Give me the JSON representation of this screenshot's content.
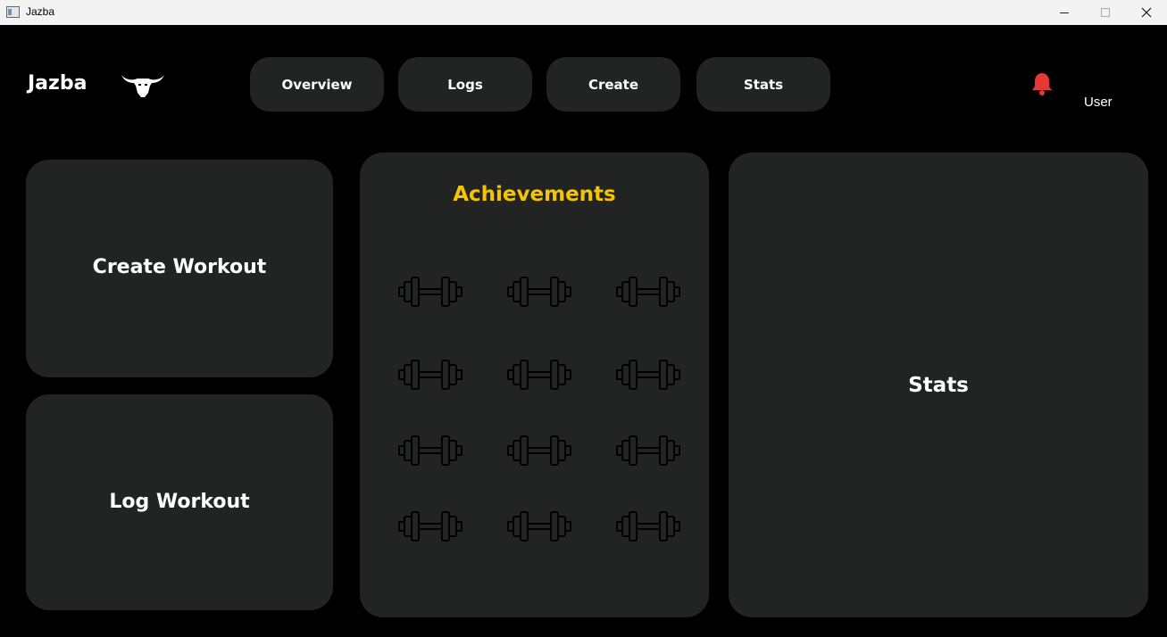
{
  "window": {
    "title": "Jazba"
  },
  "header": {
    "brand": "Jazba",
    "logo_icon": "bull-head-icon",
    "nav": [
      {
        "label": "Overview"
      },
      {
        "label": "Logs"
      },
      {
        "label": "Create"
      },
      {
        "label": "Stats"
      }
    ],
    "notification_icon": "bell-icon",
    "notification_color": "#e53935",
    "user_label": "User"
  },
  "cards": {
    "create_workout": "Create Workout",
    "log_workout": "Log Workout",
    "stats": "Stats"
  },
  "achievements": {
    "title": "Achievements",
    "title_color": "#f5c400",
    "badge_icon": "dumbbell-icon",
    "badge_count": 12
  },
  "theme": {
    "background": "#000000",
    "card": "#222423",
    "text": "#ffffff"
  }
}
